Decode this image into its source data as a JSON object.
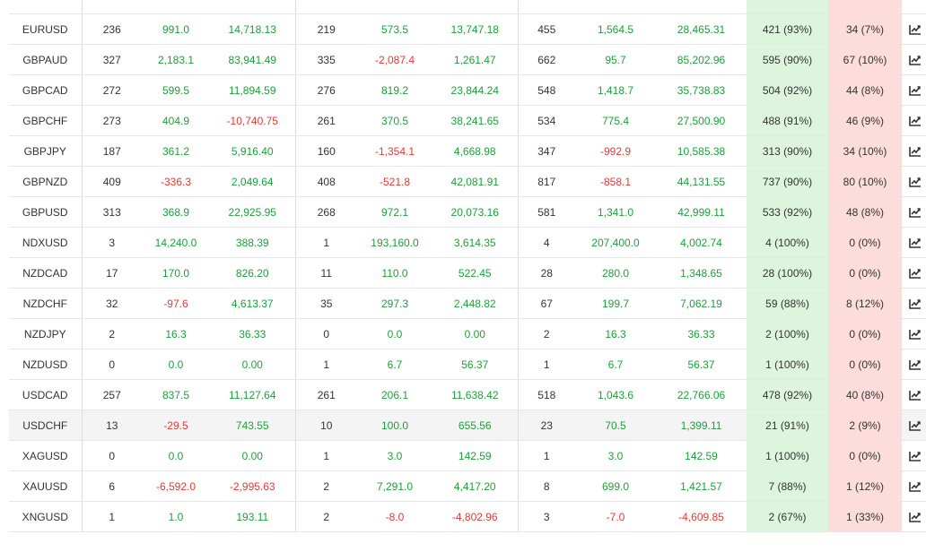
{
  "colors": {
    "positive": "#1e9e3c",
    "negative": "#e53935",
    "win_bg": "#ddf5dd",
    "loss_bg": "#fddcdc"
  },
  "icons": {
    "row_action": "chart-line-icon"
  },
  "highlighted_row": "USDCHF",
  "rows": [
    {
      "symbol": "EURUSD",
      "c1": "236",
      "c2": "991.0",
      "c3": "14,718.13",
      "c4": "219",
      "c5": "573.5",
      "c6": "13,747.18",
      "c7": "455",
      "c8": "1,564.5",
      "c9": "28,465.31",
      "win": "421 (93%)",
      "loss": "34 (7%)"
    },
    {
      "symbol": "GBPAUD",
      "c1": "327",
      "c2": "2,183.1",
      "c3": "83,941.49",
      "c4": "335",
      "c5": "-2,087.4",
      "c6": "1,261.47",
      "c7": "662",
      "c8": "95.7",
      "c9": "85,202.96",
      "win": "595 (90%)",
      "loss": "67 (10%)"
    },
    {
      "symbol": "GBPCAD",
      "c1": "272",
      "c2": "599.5",
      "c3": "11,894.59",
      "c4": "276",
      "c5": "819.2",
      "c6": "23,844.24",
      "c7": "548",
      "c8": "1,418.7",
      "c9": "35,738.83",
      "win": "504 (92%)",
      "loss": "44 (8%)"
    },
    {
      "symbol": "GBPCHF",
      "c1": "273",
      "c2": "404.9",
      "c3": "-10,740.75",
      "c4": "261",
      "c5": "370.5",
      "c6": "38,241.65",
      "c7": "534",
      "c8": "775.4",
      "c9": "27,500.90",
      "win": "488 (91%)",
      "loss": "46 (9%)"
    },
    {
      "symbol": "GBPJPY",
      "c1": "187",
      "c2": "361.2",
      "c3": "5,916.40",
      "c4": "160",
      "c5": "-1,354.1",
      "c6": "4,668.98",
      "c7": "347",
      "c8": "-992.9",
      "c9": "10,585.38",
      "win": "313 (90%)",
      "loss": "34 (10%)"
    },
    {
      "symbol": "GBPNZD",
      "c1": "409",
      "c2": "-336.3",
      "c3": "2,049.64",
      "c4": "408",
      "c5": "-521.8",
      "c6": "42,081.91",
      "c7": "817",
      "c8": "-858.1",
      "c9": "44,131.55",
      "win": "737 (90%)",
      "loss": "80 (10%)"
    },
    {
      "symbol": "GBPUSD",
      "c1": "313",
      "c2": "368.9",
      "c3": "22,925.95",
      "c4": "268",
      "c5": "972.1",
      "c6": "20,073.16",
      "c7": "581",
      "c8": "1,341.0",
      "c9": "42,999.11",
      "win": "533 (92%)",
      "loss": "48 (8%)"
    },
    {
      "symbol": "NDXUSD",
      "c1": "3",
      "c2": "14,240.0",
      "c3": "388.39",
      "c4": "1",
      "c5": "193,160.0",
      "c6": "3,614.35",
      "c7": "4",
      "c8": "207,400.0",
      "c9": "4,002.74",
      "win": "4 (100%)",
      "loss": "0 (0%)"
    },
    {
      "symbol": "NZDCAD",
      "c1": "17",
      "c2": "170.0",
      "c3": "826.20",
      "c4": "11",
      "c5": "110.0",
      "c6": "522.45",
      "c7": "28",
      "c8": "280.0",
      "c9": "1,348.65",
      "win": "28 (100%)",
      "loss": "0 (0%)"
    },
    {
      "symbol": "NZDCHF",
      "c1": "32",
      "c2": "-97.6",
      "c3": "4,613.37",
      "c4": "35",
      "c5": "297.3",
      "c6": "2,448.82",
      "c7": "67",
      "c8": "199.7",
      "c9": "7,062.19",
      "win": "59 (88%)",
      "loss": "8 (12%)"
    },
    {
      "symbol": "NZDJPY",
      "c1": "2",
      "c2": "16.3",
      "c3": "36.33",
      "c4": "0",
      "c5": "0.0",
      "c6": "0.00",
      "c7": "2",
      "c8": "16.3",
      "c9": "36.33",
      "win": "2 (100%)",
      "loss": "0 (0%)"
    },
    {
      "symbol": "NZDUSD",
      "c1": "0",
      "c2": "0.0",
      "c3": "0.00",
      "c4": "1",
      "c5": "6.7",
      "c6": "56.37",
      "c7": "1",
      "c8": "6.7",
      "c9": "56.37",
      "win": "1 (100%)",
      "loss": "0 (0%)"
    },
    {
      "symbol": "USDCAD",
      "c1": "257",
      "c2": "837.5",
      "c3": "11,127.64",
      "c4": "261",
      "c5": "206.1",
      "c6": "11,638.42",
      "c7": "518",
      "c8": "1,043.6",
      "c9": "22,766.06",
      "win": "478 (92%)",
      "loss": "40 (8%)"
    },
    {
      "symbol": "USDCHF",
      "c1": "13",
      "c2": "-29.5",
      "c3": "743.55",
      "c4": "10",
      "c5": "100.0",
      "c6": "655.56",
      "c7": "23",
      "c8": "70.5",
      "c9": "1,399.11",
      "win": "21 (91%)",
      "loss": "2 (9%)"
    },
    {
      "symbol": "XAGUSD",
      "c1": "0",
      "c2": "0.0",
      "c3": "0.00",
      "c4": "1",
      "c5": "3.0",
      "c6": "142.59",
      "c7": "1",
      "c8": "3.0",
      "c9": "142.59",
      "win": "1 (100%)",
      "loss": "0 (0%)"
    },
    {
      "symbol": "XAUUSD",
      "c1": "6",
      "c2": "-6,592.0",
      "c3": "-2,995.63",
      "c4": "2",
      "c5": "7,291.0",
      "c6": "4,417.20",
      "c7": "8",
      "c8": "699.0",
      "c9": "1,421.57",
      "win": "7 (88%)",
      "loss": "1 (12%)"
    },
    {
      "symbol": "XNGUSD",
      "c1": "1",
      "c2": "1.0",
      "c3": "193.11",
      "c4": "2",
      "c5": "-8.0",
      "c6": "-4,802.96",
      "c7": "3",
      "c8": "-7.0",
      "c9": "-4,609.85",
      "win": "2 (67%)",
      "loss": "1 (33%)"
    }
  ]
}
